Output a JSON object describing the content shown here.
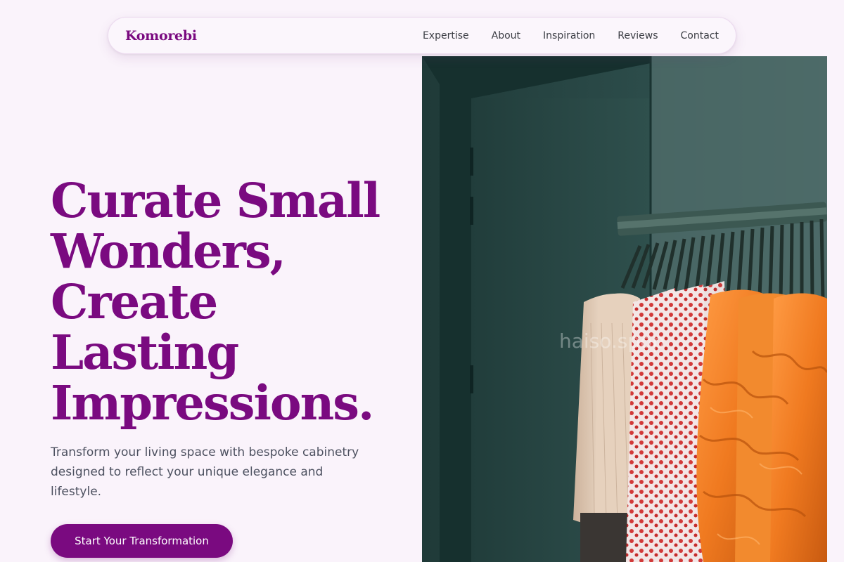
{
  "nav": {
    "brand": "Komorebi",
    "links": [
      "Expertise",
      "About",
      "Inspiration",
      "Reviews",
      "Contact"
    ]
  },
  "hero": {
    "title_lines": [
      "Curate Small",
      "Wonders,",
      "Create",
      "Lasting",
      "Impressions."
    ],
    "subtitle": "Transform your living space with bespoke cabinetry designed to reflect your unique elegance and lifestyle.",
    "cta_label": "Start Your Transformation",
    "image_watermark": "haiso.spop"
  },
  "colors": {
    "brand": "#7a0a80",
    "background": "#faf3fb",
    "text": "#4d5160",
    "nav_text": "#3b3d44"
  }
}
